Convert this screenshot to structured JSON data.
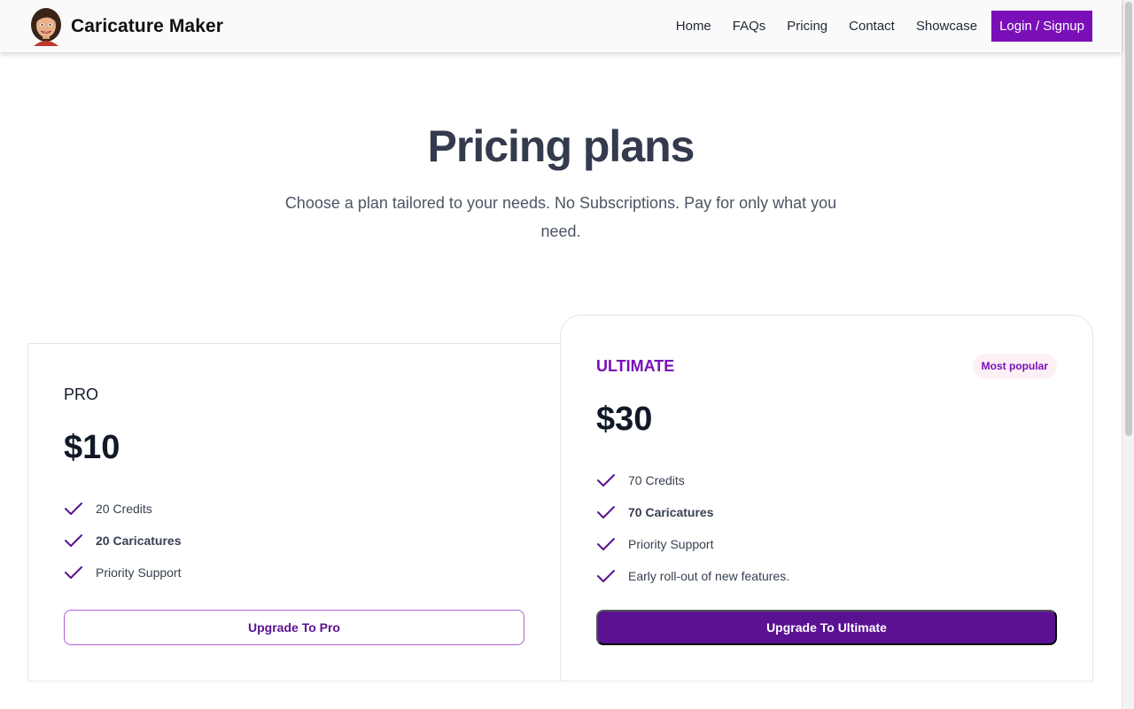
{
  "header": {
    "brand_name": "Caricature Maker",
    "nav": [
      {
        "label": "Home"
      },
      {
        "label": "FAQs"
      },
      {
        "label": "Pricing"
      },
      {
        "label": "Contact"
      },
      {
        "label": "Showcase"
      }
    ],
    "login_label": "Login / Signup"
  },
  "hero": {
    "title": "Pricing plans",
    "subtitle": "Choose a plan tailored to your needs. No Subscriptions. Pay for only what you need."
  },
  "plans": [
    {
      "name": "PRO",
      "price": "$10",
      "features": [
        "20 Credits",
        "20 Caricatures",
        "Priority Support"
      ],
      "button_label": "Upgrade To Pro"
    },
    {
      "name": "ULTIMATE",
      "badge": "Most popular",
      "price": "$30",
      "features": [
        "70 Credits",
        "70 Caricatures",
        "Priority Support",
        "Early roll-out of new features."
      ],
      "button_label": "Upgrade To Ultimate"
    }
  ],
  "colors": {
    "accent": "#7a0fb8",
    "button_dark": "#5b1292",
    "badge_bg": "#fcf0f5"
  },
  "icons": {
    "logo": "caricature-avatar-icon",
    "feature": "check-icon"
  }
}
